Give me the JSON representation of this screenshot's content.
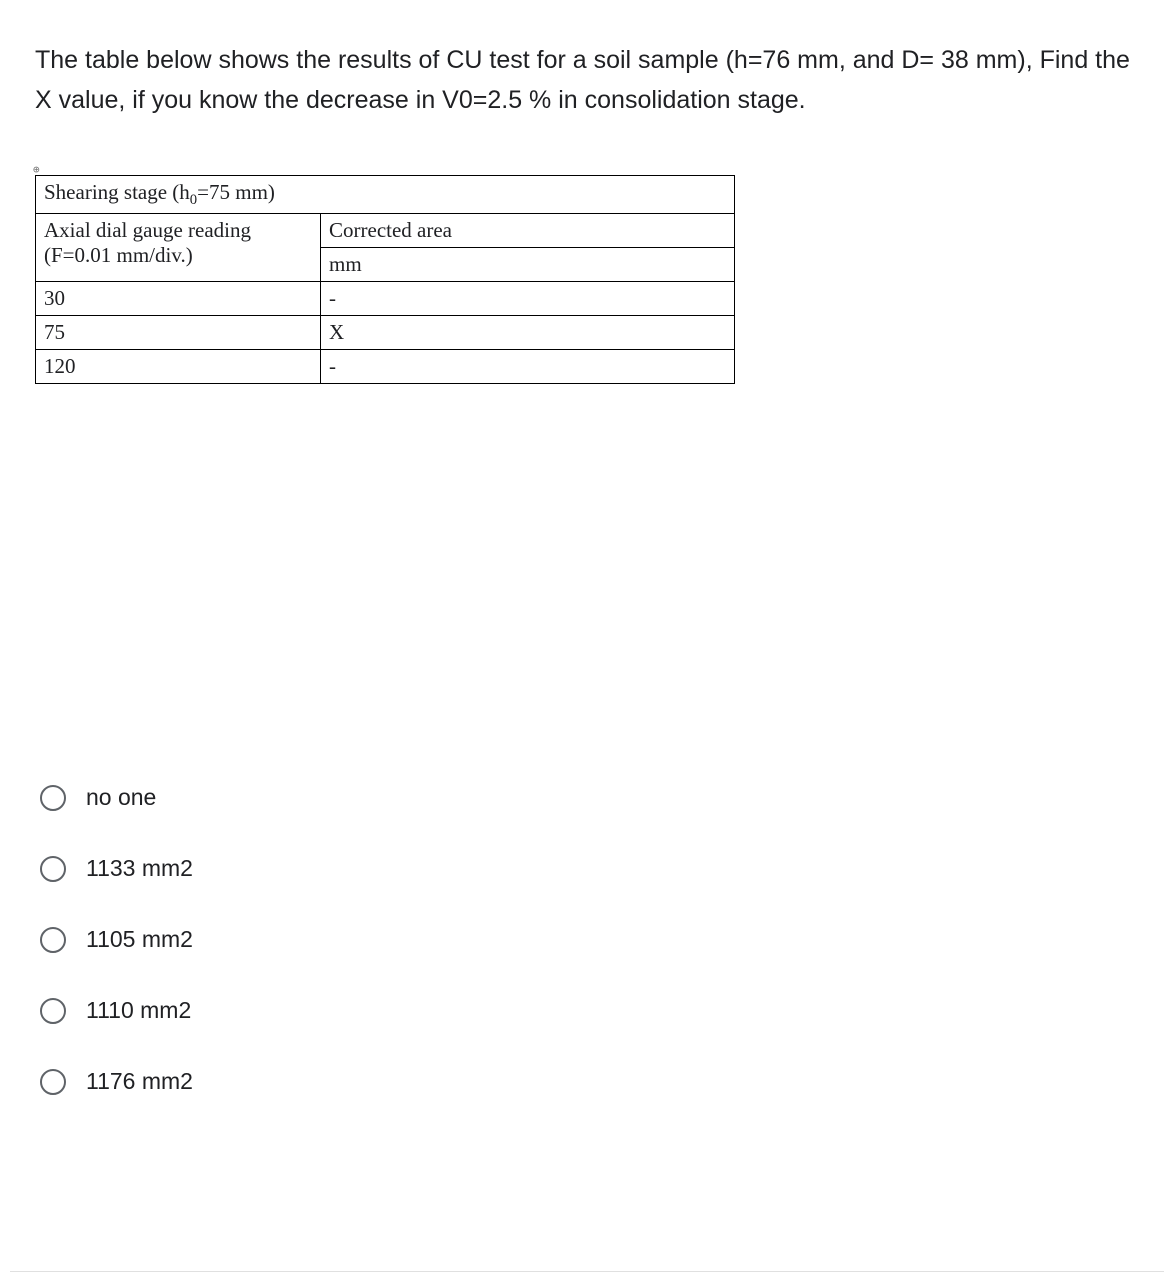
{
  "question": "The table below shows the results of CU test for a soil sample (h=76 mm, and D= 38 mm), Find the X value, if you know the decrease in V0=2.5 % in consolidation stage.",
  "table": {
    "title_prefix": "Shearing stage (h",
    "title_suffix": "=75 mm)",
    "title_sub": "0",
    "col1_header_line1": "Axial dial gauge reading",
    "col1_header_line2": "(F=0.01 mm/div.)",
    "col2_header_line1": "Corrected area",
    "col2_header_line2": "mm",
    "rows": [
      {
        "reading": "30",
        "corrected": "-"
      },
      {
        "reading": "75",
        "corrected": "X"
      },
      {
        "reading": "120",
        "corrected": "-"
      }
    ]
  },
  "options": [
    {
      "label": "no one"
    },
    {
      "label": "1133 mm2"
    },
    {
      "label": "1105 mm2"
    },
    {
      "label": "1110 mm2"
    },
    {
      "label": "1176 mm2"
    }
  ],
  "anchor_glyph": "⊕"
}
